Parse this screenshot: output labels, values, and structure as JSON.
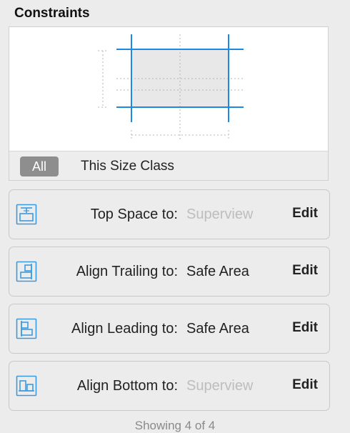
{
  "section": {
    "title": "Constraints"
  },
  "filter": {
    "all_label": "All",
    "size_class_label": "This Size Class"
  },
  "constraints": [
    {
      "label": "Top Space to:",
      "value": "Superview",
      "value_style": "dim",
      "edit": "Edit",
      "icon": "top-space-icon"
    },
    {
      "label": "Align Trailing to:",
      "value": "Safe Area",
      "value_style": "dark",
      "edit": "Edit",
      "icon": "align-trailing-icon"
    },
    {
      "label": "Align Leading to:",
      "value": "Safe Area",
      "value_style": "dark",
      "edit": "Edit",
      "icon": "align-leading-icon"
    },
    {
      "label": "Align Bottom to:",
      "value": "Superview",
      "value_style": "dim",
      "edit": "Edit",
      "icon": "align-bottom-icon"
    }
  ],
  "footer": {
    "text": "Showing 4 of 4"
  },
  "colors": {
    "accent": "#1e88e5",
    "icon": "#3a9be0",
    "selected_segment": "#8e8e8e"
  }
}
